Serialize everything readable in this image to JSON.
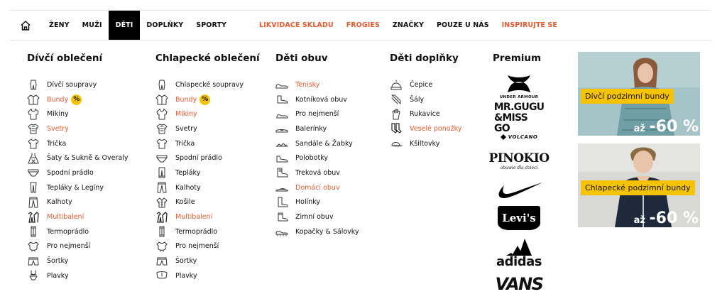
{
  "nav": {
    "items": [
      {
        "label": "ŽENY",
        "style": "normal"
      },
      {
        "label": "MUŽI",
        "style": "normal"
      },
      {
        "label": "DĚTI",
        "style": "active"
      },
      {
        "label": "DOPLŇKY",
        "style": "normal"
      },
      {
        "label": "SPORTY",
        "style": "normal"
      }
    ],
    "items2": [
      {
        "label": "LIKVIDACE SKLADU",
        "style": "orange"
      },
      {
        "label": "FROGIES",
        "style": "orange"
      },
      {
        "label": "ZNAČKY",
        "style": "normal"
      },
      {
        "label": "POUZE U NÁS",
        "style": "normal"
      },
      {
        "label": "INSPIRUJTE SE",
        "style": "orange"
      }
    ]
  },
  "columns": {
    "girls": {
      "title": "Dívčí oblečení",
      "items": [
        {
          "label": "Dívčí soupravy",
          "icon": "set-icon"
        },
        {
          "label": "Bundy",
          "icon": "jacket-icon",
          "highlight": true,
          "badge": "%"
        },
        {
          "label": "Mikiny",
          "icon": "hoodie-icon"
        },
        {
          "label": "Svetry",
          "icon": "sweater-icon",
          "highlight": true
        },
        {
          "label": "Trička",
          "icon": "tshirt-icon"
        },
        {
          "label": "Šaty & Sukně & Overaly",
          "icon": "dress-icon"
        },
        {
          "label": "Spodní prádlo",
          "icon": "underwear-icon"
        },
        {
          "label": "Tepláky & Legíny",
          "icon": "leggings-icon"
        },
        {
          "label": "Kalhoty",
          "icon": "trousers-icon"
        },
        {
          "label": "Multibalení",
          "icon": "multipack-icon",
          "highlight": true
        },
        {
          "label": "Termoprádlo",
          "icon": "thermo-icon"
        },
        {
          "label": "Pro nejmenší",
          "icon": "baby-icon"
        },
        {
          "label": "Šortky",
          "icon": "shorts-icon"
        },
        {
          "label": "Plavky",
          "icon": "swimsuit-icon"
        }
      ]
    },
    "boys": {
      "title": "Chlapecké oblečení",
      "items": [
        {
          "label": "Chlapecké soupravy",
          "icon": "set-icon"
        },
        {
          "label": "Bundy",
          "icon": "jacket-icon",
          "highlight": true,
          "badge": "%"
        },
        {
          "label": "Mikiny",
          "icon": "hoodie-icon",
          "highlight": true
        },
        {
          "label": "Svetry",
          "icon": "sweater-icon"
        },
        {
          "label": "Trička",
          "icon": "tshirt-icon"
        },
        {
          "label": "Spodní prádlo",
          "icon": "underwear-icon"
        },
        {
          "label": "Tepláky",
          "icon": "sweatpants-icon"
        },
        {
          "label": "Kalhoty",
          "icon": "trousers-icon"
        },
        {
          "label": "Košile",
          "icon": "shirt-icon"
        },
        {
          "label": "Multibalení",
          "icon": "multipack-icon",
          "highlight": true
        },
        {
          "label": "Termoprádlo",
          "icon": "thermo-icon"
        },
        {
          "label": "Pro nejmenší",
          "icon": "baby-icon"
        },
        {
          "label": "Šortky",
          "icon": "shorts-icon"
        },
        {
          "label": "Plavky",
          "icon": "swimtrunks-icon"
        }
      ]
    },
    "shoes": {
      "title": "Děti obuv",
      "items": [
        {
          "label": "Tenisky",
          "icon": "sneaker-icon",
          "highlight": true
        },
        {
          "label": "Kotníková obuv",
          "icon": "ankle-boot-icon"
        },
        {
          "label": "Pro nejmenší",
          "icon": "baby-shoe-icon"
        },
        {
          "label": "Balerínky",
          "icon": "ballerina-icon"
        },
        {
          "label": "Sandále & Žabky",
          "icon": "sandal-icon"
        },
        {
          "label": "Polobotky",
          "icon": "low-shoe-icon"
        },
        {
          "label": "Treková obuv",
          "icon": "hiking-boot-icon"
        },
        {
          "label": "Domácí obuv",
          "icon": "slipper-icon",
          "highlight": true
        },
        {
          "label": "Holínky",
          "icon": "rain-boot-icon"
        },
        {
          "label": "Zimní obuv",
          "icon": "winter-boot-icon"
        },
        {
          "label": "Kopačky & Sálovky",
          "icon": "football-boot-icon"
        }
      ]
    },
    "accessories": {
      "title": "Děti doplňky",
      "items": [
        {
          "label": "Čepice",
          "icon": "beanie-icon"
        },
        {
          "label": "Šály",
          "icon": "scarf-icon"
        },
        {
          "label": "Rukavice",
          "icon": "glove-icon"
        },
        {
          "label": "Veselé ponožky",
          "icon": "socks-icon",
          "highlight": true
        },
        {
          "label": "Kšiltovky",
          "icon": "cap-icon"
        }
      ]
    }
  },
  "premium": {
    "title": "Premium",
    "brands": {
      "under_armour": "UNDER ARMOUR",
      "mrgugu_line1": "MR.GUGU",
      "mrgugu_line2": "&MISS GO",
      "volcano": "VOLCANO",
      "pinokio": "PINOKIO",
      "pinokio_sub": "obuwie dla dzieci",
      "nike": "nike",
      "levis": "Levi's",
      "adidas": "adidas",
      "vans": "VANS"
    }
  },
  "promos": [
    {
      "label": "Dívčí podzimní bundy",
      "prefix": "až",
      "discount": "-60 %"
    },
    {
      "label": "Chlapecké podzimní bundy",
      "prefix": "až",
      "discount": "-60 %"
    }
  ],
  "colors": {
    "accent": "#ea5a2e",
    "badge": "#f6c300",
    "text": "#111111"
  }
}
